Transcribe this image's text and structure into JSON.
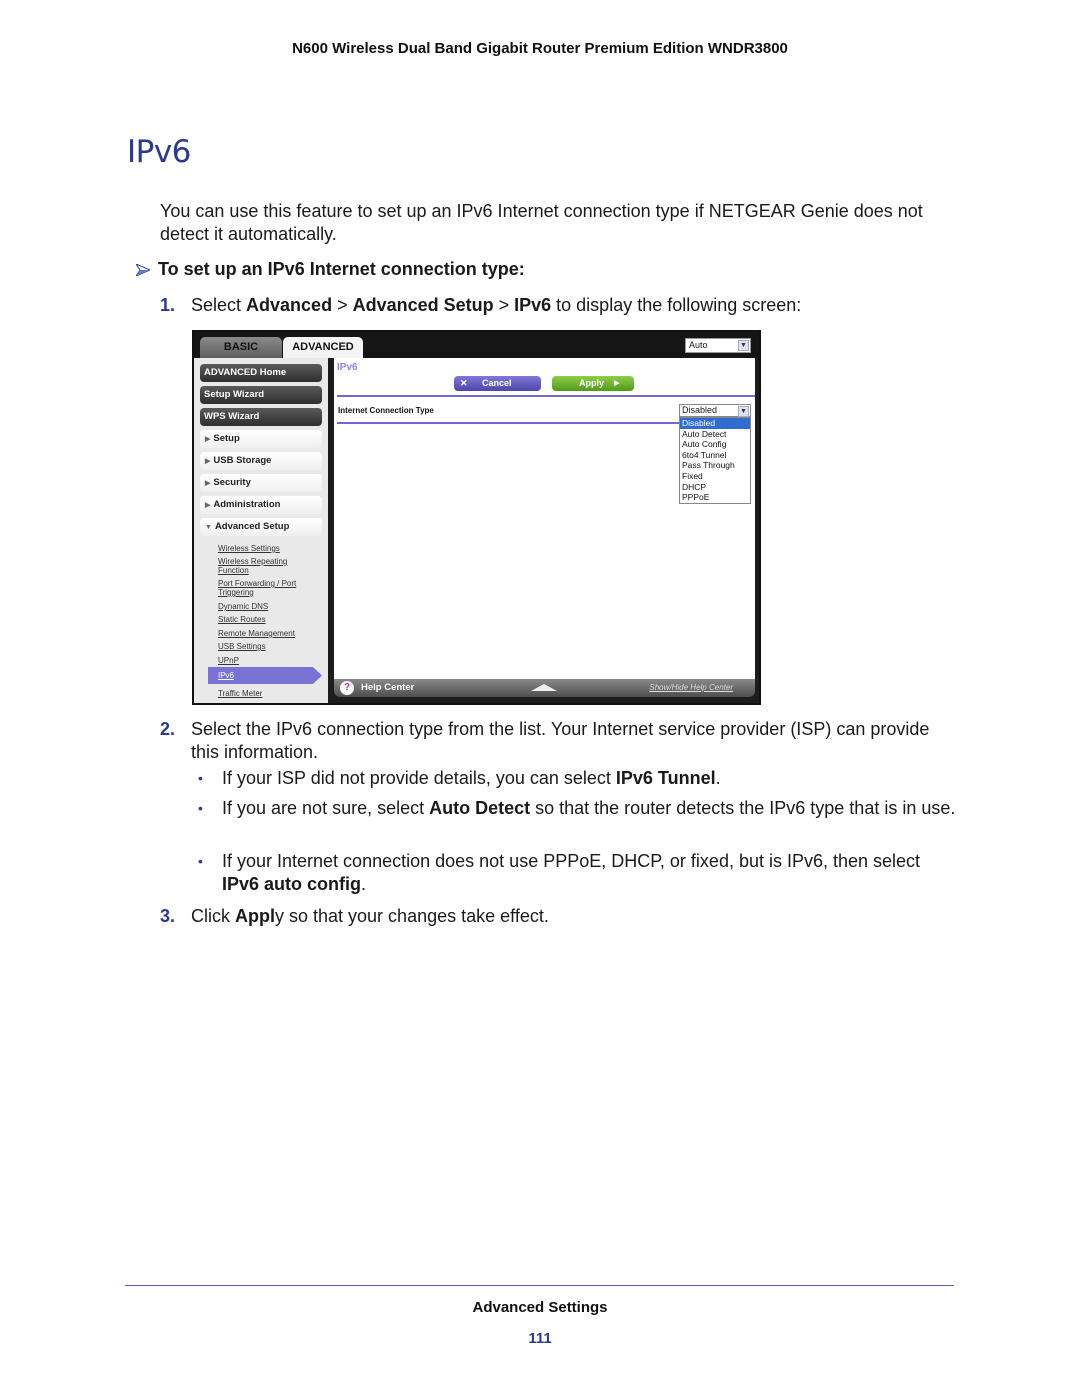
{
  "header": {
    "running_title": "N600 Wireless Dual Band Gigabit Router Premium Edition WNDR3800"
  },
  "section": {
    "title": "IPv6"
  },
  "intro": "You can use this feature to set up an IPv6 Internet connection type if NETGEAR Genie does not detect it automatically.",
  "procedure": {
    "heading": "To set up an IPv6 Internet connection type:",
    "heading_icon": "arrow-pointer-icon",
    "steps": [
      {
        "num": "1.",
        "parts": [
          {
            "t": "Select ",
            "b": false
          },
          {
            "t": "Advanced",
            "b": true
          },
          {
            "t": " > ",
            "b": false
          },
          {
            "t": "Advanced Setup",
            "b": true
          },
          {
            "t": " > ",
            "b": false
          },
          {
            "t": "IPv6",
            "b": true
          },
          {
            "t": " to display the following screen:",
            "b": false
          }
        ]
      },
      {
        "num": "2.",
        "parts": [
          {
            "t": "Select the IPv6 connection type from the list. Your Internet service provider (ISP) can provide this information.",
            "b": false
          }
        ]
      },
      {
        "num": "3.",
        "parts": [
          {
            "t": "Click ",
            "b": false
          },
          {
            "t": "Appl",
            "b": true
          },
          {
            "t": "y so that your changes take effect.",
            "b": false
          }
        ]
      }
    ],
    "bullets": [
      {
        "parts": [
          {
            "t": "If your ISP did not provide details, you can select ",
            "b": false
          },
          {
            "t": "IPv6 Tunnel",
            "b": true
          },
          {
            "t": ".",
            "b": false
          }
        ]
      },
      {
        "parts": [
          {
            "t": "If you are not sure, select ",
            "b": false
          },
          {
            "t": "Auto Detect",
            "b": true
          },
          {
            "t": " so that the router detects the IPv6 type that is in use.",
            "b": false
          }
        ]
      },
      {
        "parts": [
          {
            "t": "If your Internet connection does not use PPPoE, DHCP, or fixed, but is IPv6, then select ",
            "b": false
          },
          {
            "t": "IPv6 auto config",
            "b": true
          },
          {
            "t": ".",
            "b": false
          }
        ]
      }
    ]
  },
  "router_ui": {
    "tabs": {
      "basic": "BASIC",
      "advanced": "ADVANCED"
    },
    "language_select": "Auto",
    "sidebar": {
      "primary": [
        "ADVANCED Home",
        "Setup Wizard",
        "WPS Wizard"
      ],
      "sections": [
        "Setup",
        "USB Storage",
        "Security",
        "Administration",
        "Advanced Setup"
      ],
      "sublinks": [
        "Wireless Settings",
        "Wireless Repeating Function",
        "Port Forwarding / Port Triggering",
        "Dynamic DNS",
        "Static Routes",
        "Remote Management",
        "USB Settings",
        "UPnP",
        "IPv6",
        "Traffic Meter"
      ],
      "active_sublink": "IPv6"
    },
    "content": {
      "title": "IPv6",
      "cancel_label": "Cancel",
      "apply_label": "Apply",
      "field_label": "Internet Connection Type",
      "selected_value": "Disabled",
      "options": [
        "Disabled",
        "Auto Detect",
        "Auto Config",
        "6to4 Tunnel",
        "Pass Through",
        "Fixed",
        "DHCP",
        "PPPoE"
      ]
    },
    "help": {
      "label": "Help Center",
      "toggle": "Show/Hide Help Center",
      "icon": "?"
    }
  },
  "footer": {
    "section": "Advanced Settings",
    "page_number": "111"
  },
  "colors": {
    "accent_blue": "#2b3990",
    "router_purple": "#7a73d6",
    "apply_green": "#5fa82a",
    "select_highlight": "#2f6dcf"
  }
}
